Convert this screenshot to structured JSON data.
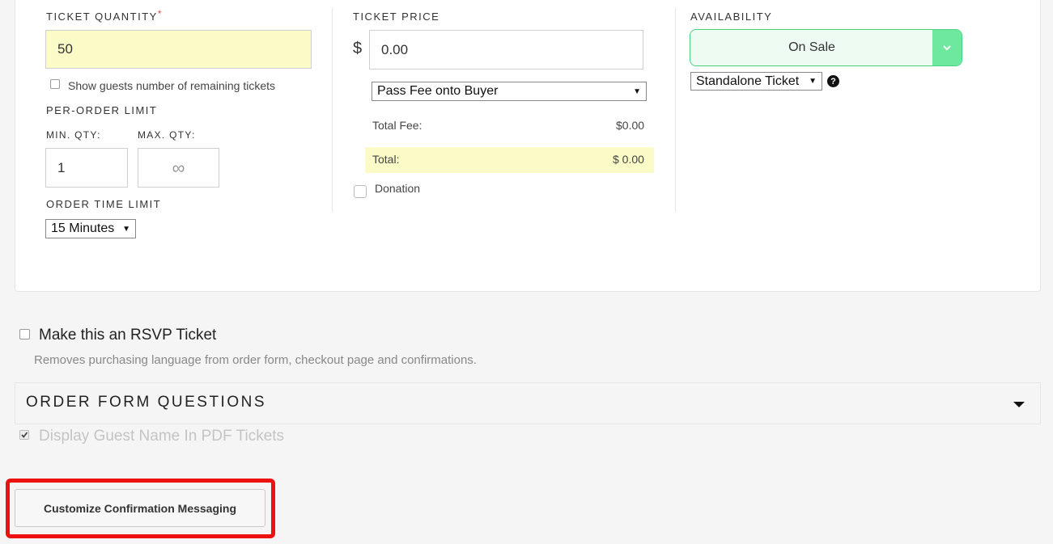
{
  "ticket_quantity": {
    "label": "TICKET QUANTITY",
    "required_mark": "*",
    "value": "50",
    "show_remaining_label": "Show guests number of remaining tickets"
  },
  "per_order_limit": {
    "label": "PER-ORDER LIMIT",
    "min_label": "MIN. QTY:",
    "min_value": "1",
    "max_label": "MAX. QTY:",
    "max_value": "∞"
  },
  "order_time_limit": {
    "label": "ORDER TIME LIMIT",
    "selected": "15 Minutes"
  },
  "ticket_price": {
    "label": "TICKET PRICE",
    "currency": "$",
    "value": "0.00",
    "fee_option": "Pass Fee onto Buyer",
    "total_fee_label": "Total Fee:",
    "total_fee_value": "$0.00",
    "total_label": "Total:",
    "total_value": "$ 0.00",
    "donation_label": "Donation"
  },
  "availability": {
    "label": "AVAILABILITY",
    "status": "On Sale",
    "ticket_type": "Standalone Ticket",
    "help_glyph": "?",
    "accent_color": "#49d37f"
  },
  "rsvp": {
    "label": "Make this an RSVP Ticket",
    "description": "Removes purchasing language from order form, checkout page and confirmations."
  },
  "order_form": {
    "title": "ORDER FORM QUESTIONS"
  },
  "display_guest_name": {
    "label": "Display Guest Name In PDF Tickets"
  },
  "confirm_button": {
    "label": "Customize Confirmation Messaging"
  }
}
